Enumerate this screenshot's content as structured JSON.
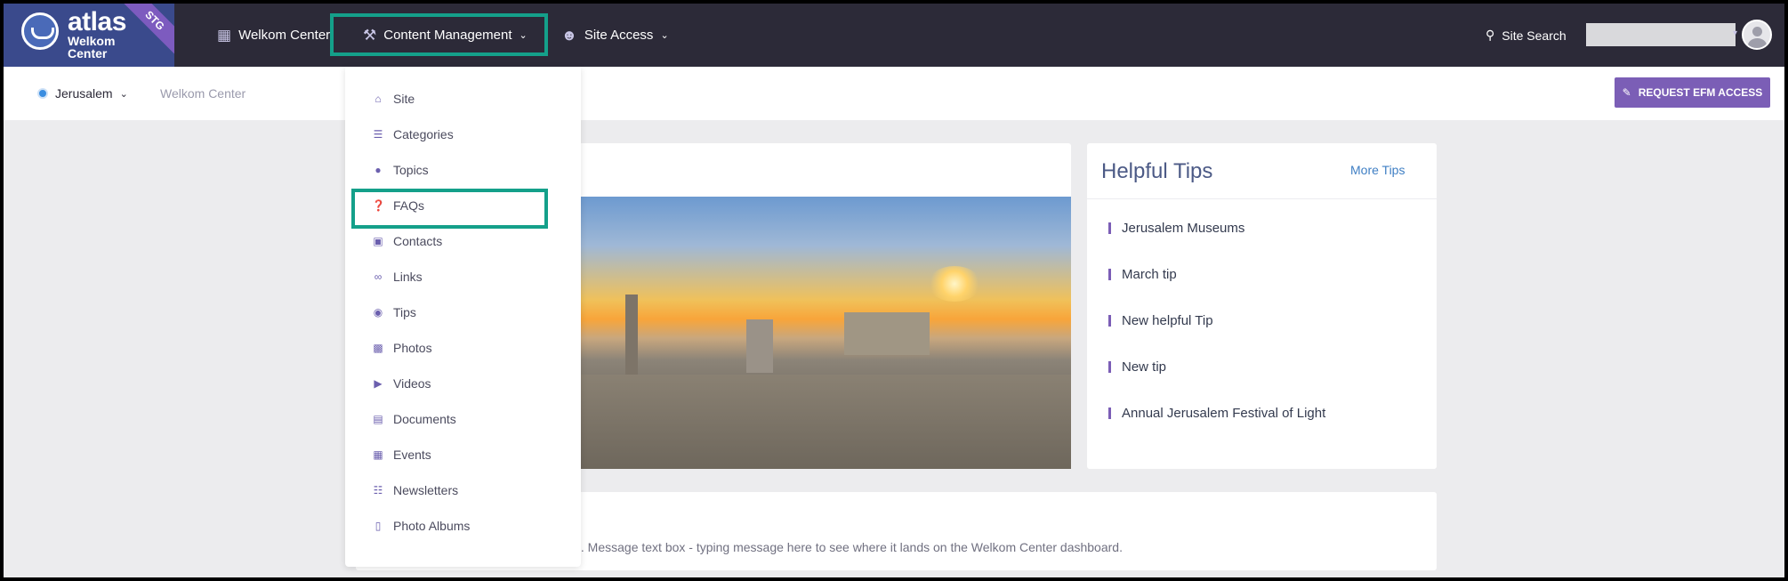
{
  "logo": {
    "brand": "atlas",
    "subtitle": "Welkom Center",
    "badge": "STG"
  },
  "nav": {
    "welkom_center": "Welkom Center",
    "content_management": "Content Management",
    "site_access": "Site Access",
    "site_search": "Site Search"
  },
  "subnav": {
    "location": "Jerusalem",
    "breadcrumb": "Welkom Center",
    "efm_button": "REQUEST EFM ACCESS"
  },
  "dropdown": {
    "items": [
      {
        "label": "Site",
        "icon": "home-icon"
      },
      {
        "label": "Categories",
        "icon": "list-icon"
      },
      {
        "label": "Topics",
        "icon": "comments-icon"
      },
      {
        "label": "FAQs",
        "icon": "question-circle-icon"
      },
      {
        "label": "Contacts",
        "icon": "contact-icon"
      },
      {
        "label": "Links",
        "icon": "link-icon"
      },
      {
        "label": "Tips",
        "icon": "lightbulb-icon"
      },
      {
        "label": "Photos",
        "icon": "images-icon"
      },
      {
        "label": "Videos",
        "icon": "video-icon"
      },
      {
        "label": "Documents",
        "icon": "document-icon"
      },
      {
        "label": "Events",
        "icon": "calendar-icon"
      },
      {
        "label": "Newsletters",
        "icon": "newspaper-icon"
      },
      {
        "label": "Photo Albums",
        "icon": "album-icon"
      }
    ]
  },
  "tips": {
    "title": "Helpful Tips",
    "more": "More Tips",
    "items": [
      "Jerusalem Museums",
      "March tip",
      "New helpful Tip",
      "New tip",
      "Annual Jerusalem Festival of Light"
    ]
  },
  "message": {
    "text": "ld. Message text box - typing message here to see where it lands on the Welkom Center dashboard."
  },
  "colors": {
    "nav_bg": "#2c2a38",
    "highlight": "#14a08a",
    "accent": "#7b5eb6"
  }
}
